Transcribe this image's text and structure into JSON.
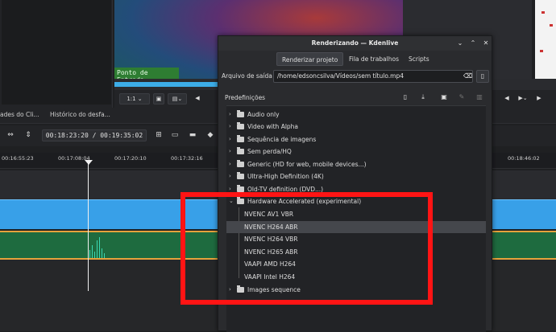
{
  "editor": {
    "monitor_marker": "Ponto de Entrada",
    "zoom_value": "1:1",
    "tabs": [
      "ades do Cli...",
      "Histórico do desfa..."
    ],
    "timecode": "00:18:23:20 / 00:19:35:02",
    "ruler_ticks": [
      "00:16:55:23",
      "00:17:08:04",
      "00:17:20:10",
      "00:17:32:16",
      "00:18:46:02"
    ]
  },
  "dialog": {
    "title": "Renderizando — Kdenlive",
    "tabs": [
      "Renderizar projeto",
      "Fila de trabalhos",
      "Scripts"
    ],
    "active_tab": "Renderizar projeto",
    "output_label": "Arquivo de saída",
    "output_value": "/home/edsoncsilva/Vídeos/sem título.mp4",
    "presets_label": "Predefinições",
    "groups": [
      "Audio only",
      "Video with Alpha",
      "Sequência de imagens",
      "Sem perda/HQ",
      "Generic (HD for web, mobile devices...)",
      "Ultra-High Definition (4K)",
      "Old-TV definition (DVD...)",
      "Hardware Accelerated (experimental)"
    ],
    "hw_children": [
      "NVENC AV1 VBR",
      "NVENC H264 ABR",
      "NVENC H264 VBR",
      "NVENC H265 ABR",
      "VAAPI AMD H264",
      "VAAPI Intel H264"
    ],
    "selected_preset": "NVENC H264 ABR",
    "last_group": "Images sequence"
  },
  "colors": {
    "annotation": "#ff1414",
    "video_track": "#38a0e8",
    "audio_track": "#1e6b3f"
  }
}
